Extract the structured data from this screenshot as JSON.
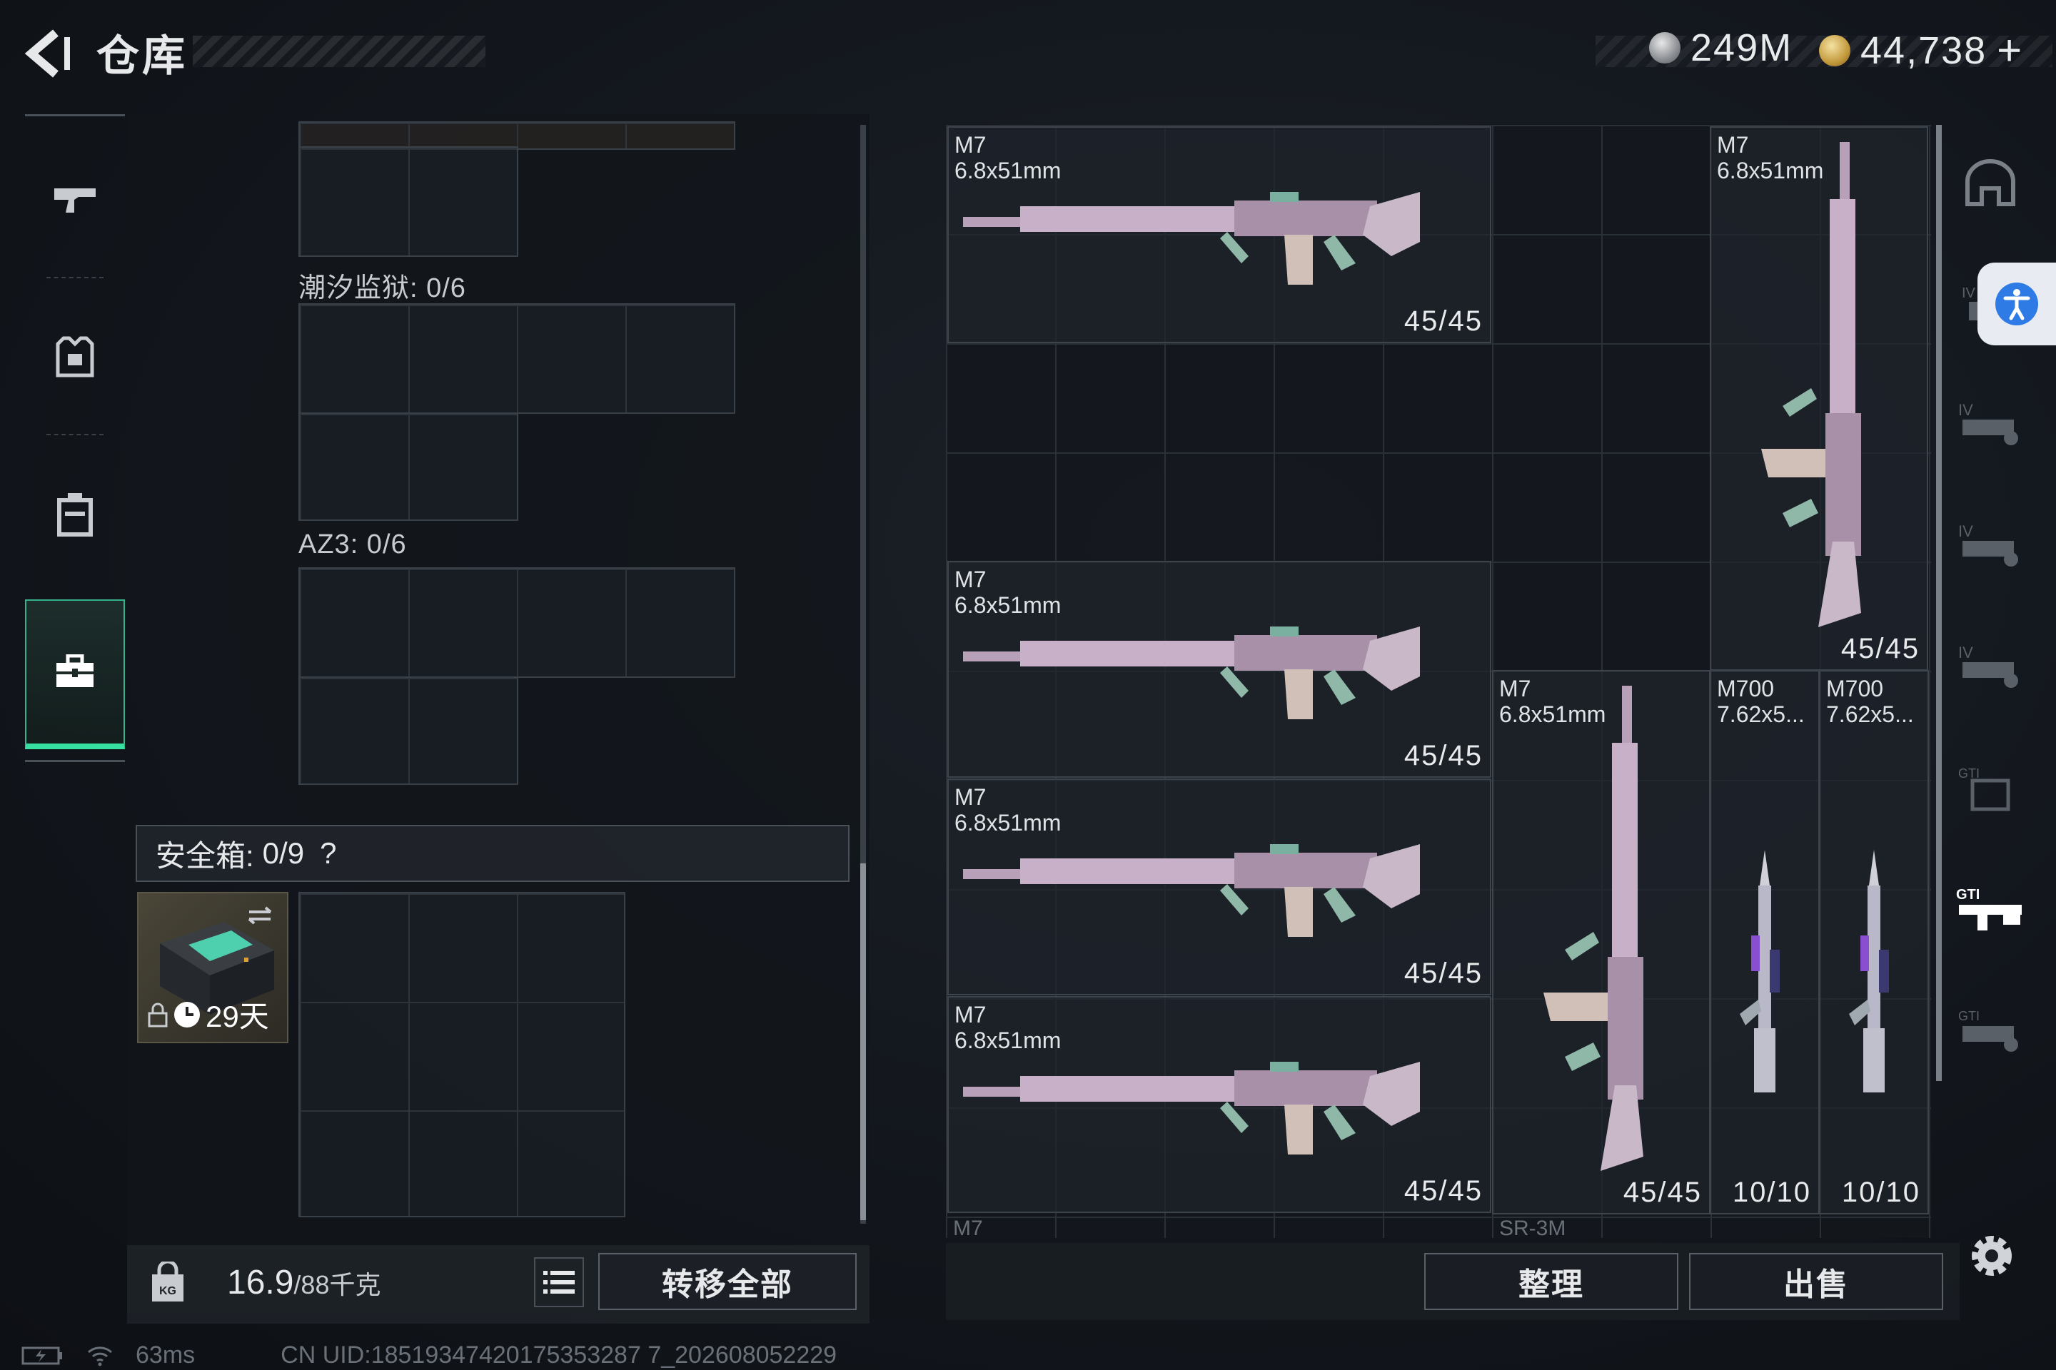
{
  "header": {
    "title": "仓库",
    "silver_amount": "249M",
    "gold_amount": "44,738",
    "gold_add": "+"
  },
  "left_nav": {
    "items": [
      {
        "icon": "gun-icon"
      },
      {
        "icon": "armor-vest-icon"
      },
      {
        "icon": "backpack-icon"
      },
      {
        "icon": "toolbox-icon",
        "active": true
      }
    ]
  },
  "containers": {
    "tidal_prison_label": "潮汐监狱: 0/6",
    "az3_label": "AZ3: 0/6",
    "safebox_label": "安全箱:",
    "safebox_count": "0/9",
    "safebox_help": "?",
    "safebox_days": "29天"
  },
  "bottom_left": {
    "weight_value": "16.9",
    "weight_max": "/88千克",
    "transfer_all": "转移全部"
  },
  "stash": {
    "items": [
      {
        "name": "M7\n6.8x51mm",
        "ammo": "45/45"
      },
      {
        "name": "M7\n6.8x51mm",
        "ammo": "45/45"
      },
      {
        "name": "M7\n6.8x51mm",
        "ammo": "45/45"
      },
      {
        "name": "M7\n6.8x51mm",
        "ammo": "45/45"
      },
      {
        "name": "M7\n6.8x51mm",
        "ammo": "45/45"
      },
      {
        "name": "M7\n6.8x51mm",
        "ammo": "45/45"
      },
      {
        "name": "M700\n7.62x5...",
        "ammo": "10/10"
      },
      {
        "name": "M700\n7.62x5...",
        "ammo": "10/10"
      }
    ],
    "next_row_left": "M7",
    "next_row_right": "SR-3M"
  },
  "actions": {
    "sort": "整理",
    "sell": "出售"
  },
  "status_bar": {
    "ping": "63ms",
    "uid": "CN UID:18519347420175353287 7_202608052229"
  },
  "colors": {
    "accent_green": "#36e0a0",
    "background": "#12161c"
  }
}
